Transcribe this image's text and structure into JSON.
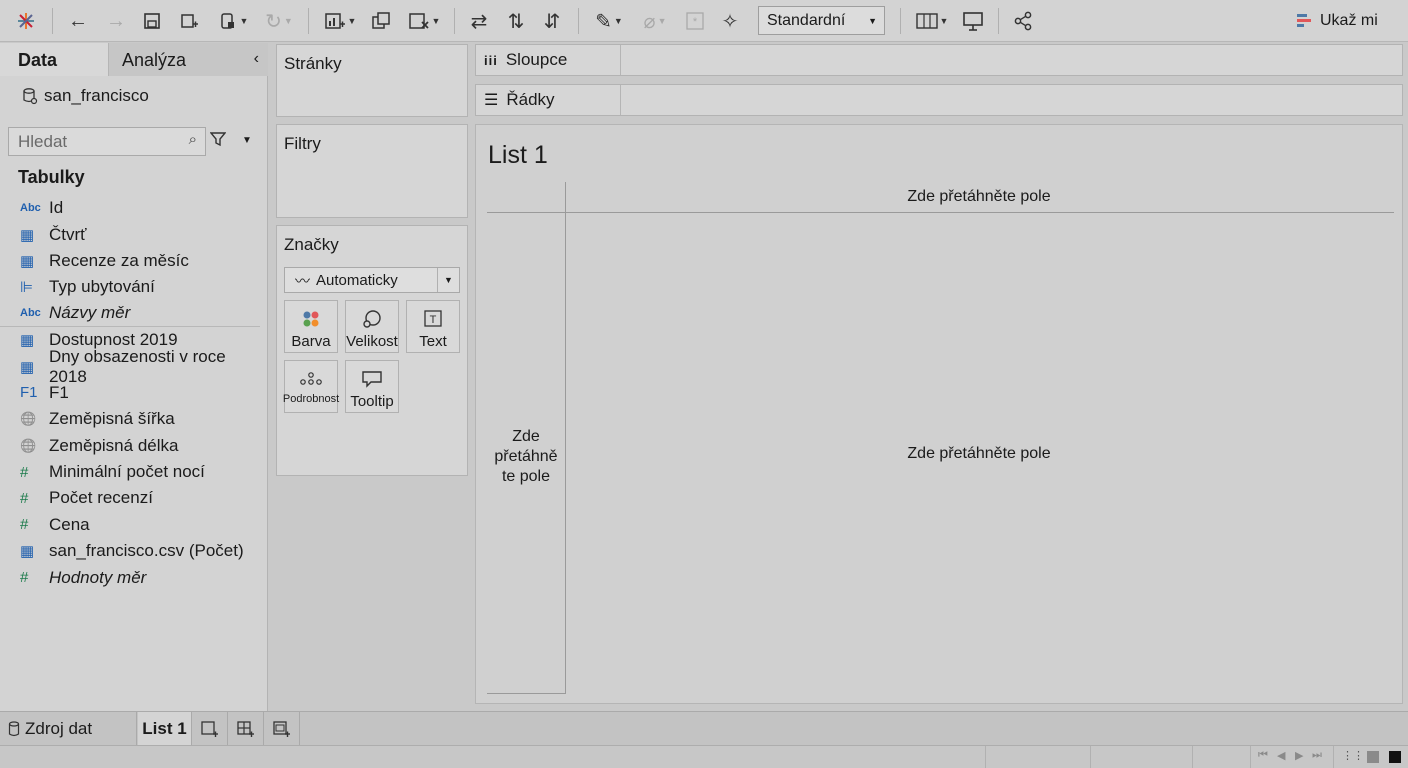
{
  "toolbar": {
    "view_mode": "Standardní",
    "show_me": "Ukaž mi"
  },
  "data_pane": {
    "tab_data": "Data",
    "tab_analysis": "Analýza",
    "datasource": "san_francisco",
    "search_placeholder": "Hledat",
    "tables_title": "Tabulky",
    "fields": [
      {
        "type": "Abc",
        "label": "Id"
      },
      {
        "type": "grid",
        "label": "Čtvrť"
      },
      {
        "type": "grid",
        "label": "Recenze za měsíc"
      },
      {
        "type": "hier",
        "label": "Typ ubytování"
      },
      {
        "type": "Abc",
        "label": "Názvy měr"
      },
      {
        "type": "grid",
        "label": "Dostupnost 2019"
      },
      {
        "type": "grid",
        "label": "Dny obsazenosti v roce 2018"
      },
      {
        "type": "F1",
        "label": "F1"
      },
      {
        "type": "globe",
        "label": "Zeměpisná šířka"
      },
      {
        "type": "globe",
        "label": "Zeměpisná délka"
      },
      {
        "type": "#",
        "label": "Minimální počet nocí"
      },
      {
        "type": "#",
        "label": "Počet recenzí"
      },
      {
        "type": "#",
        "label": "Cena"
      },
      {
        "type": "grid",
        "label": "san_francisco.csv (Počet)"
      },
      {
        "type": "#",
        "label": "Hodnoty měr"
      }
    ]
  },
  "cards": {
    "pages": "Stránky",
    "filters": "Filtry",
    "marks": "Značky",
    "mark_type": "Automaticky",
    "buttons": {
      "color": "Barva",
      "size": "Velikost",
      "text": "Text",
      "detail": "Podrobnost",
      "tooltip": "Tooltip"
    }
  },
  "shelves": {
    "columns": "Sloupce",
    "rows": "Řádky"
  },
  "canvas": {
    "title": "List 1",
    "drop_top": "Zde přetáhněte pole",
    "drop_left": "Zde přetáhněte pole",
    "drop_center": "Zde přetáhněte pole"
  },
  "bottom": {
    "datasource_tab": "Zdroj dat",
    "sheet_tab": "List 1"
  }
}
